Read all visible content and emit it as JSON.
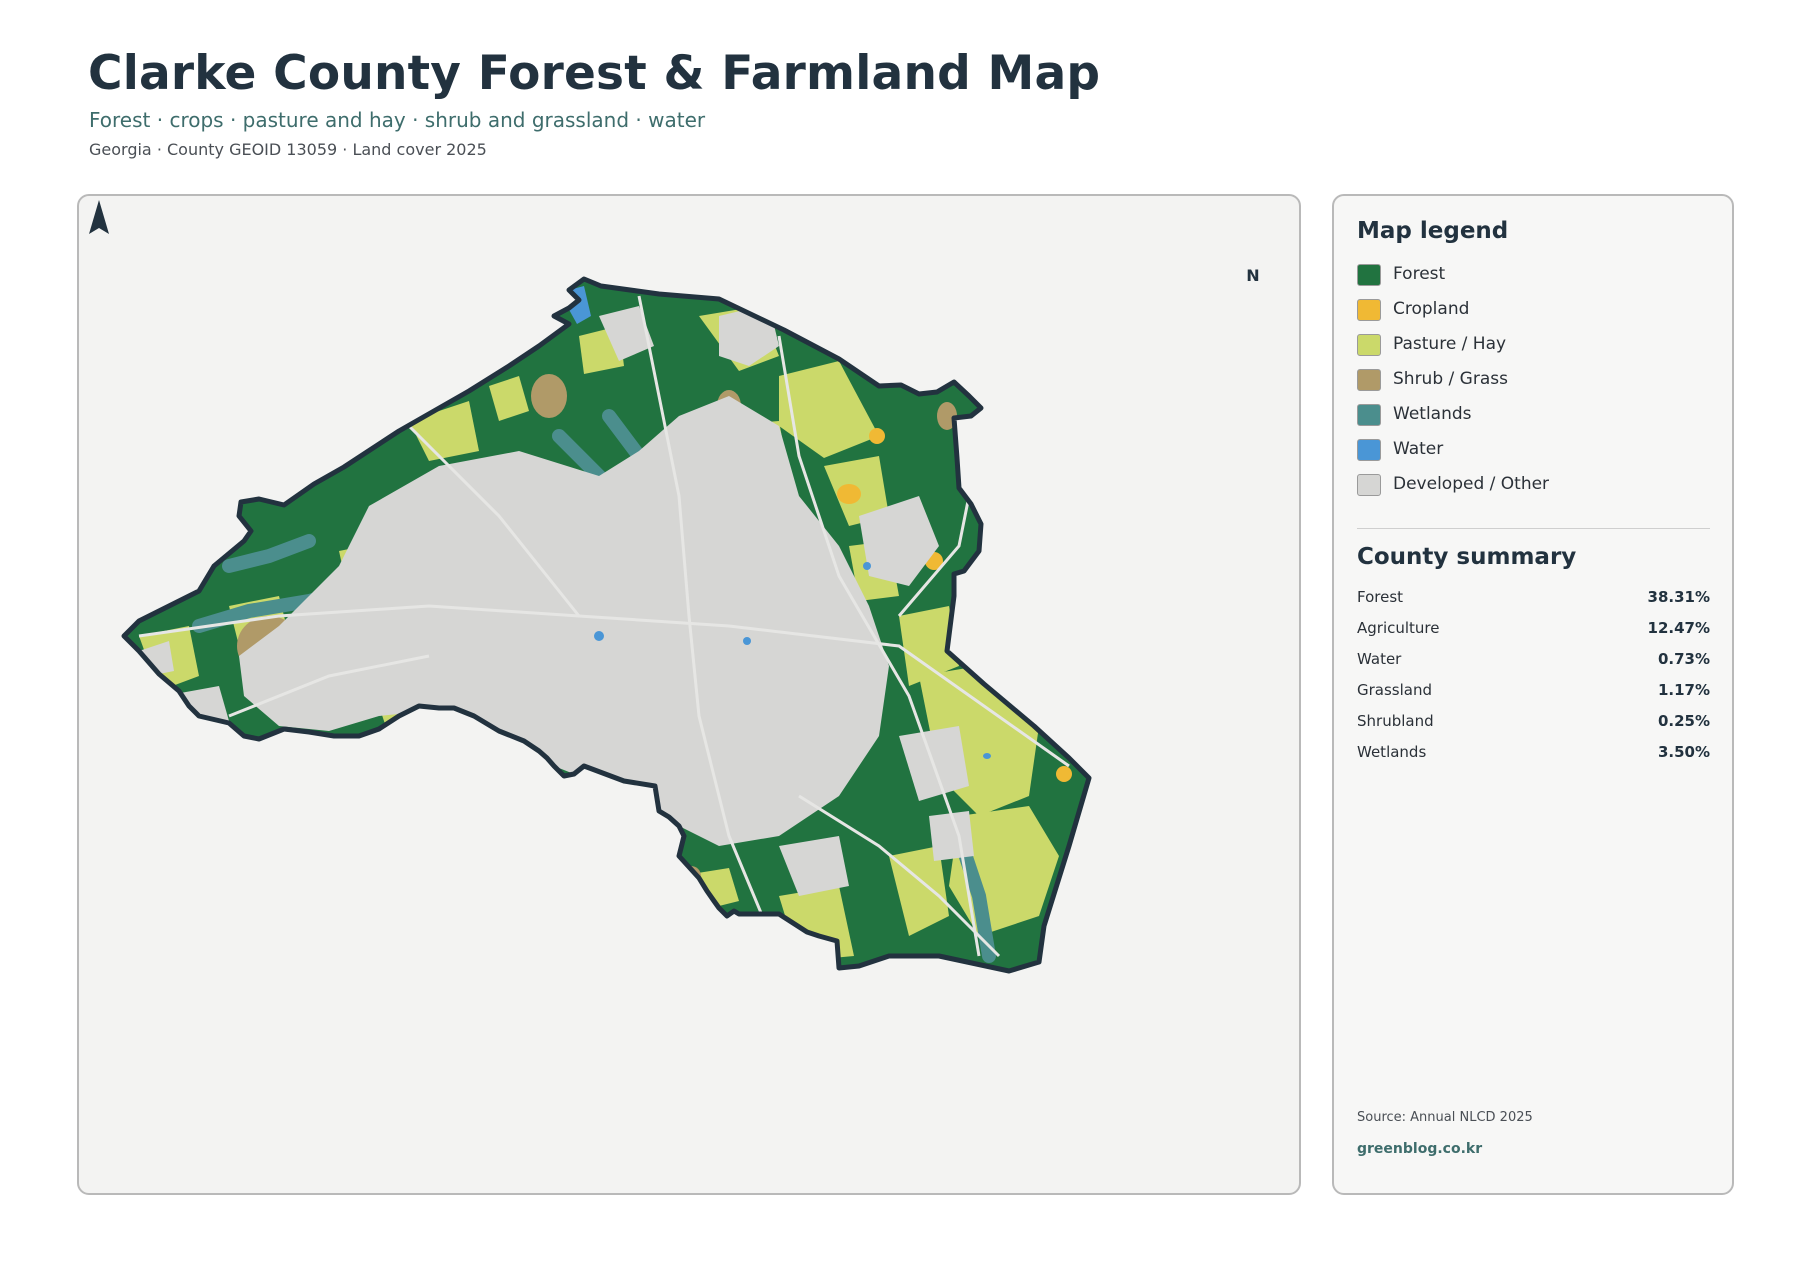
{
  "header": {
    "title": "Clarke County Forest & Farmland Map",
    "subtitle": "Forest · crops · pasture and hay · shrub and grassland · water",
    "meta": "Georgia · County GEOID 13059 · Land cover 2025"
  },
  "map": {
    "north_label": "N",
    "north_icon": "north-arrow-icon"
  },
  "legend": {
    "title": "Map legend",
    "items": [
      {
        "label": "Forest",
        "color": "#217340"
      },
      {
        "label": "Cropland",
        "color": "#f0b934"
      },
      {
        "label": "Pasture / Hay",
        "color": "#cbd96a"
      },
      {
        "label": "Shrub / Grass",
        "color": "#b09a68"
      },
      {
        "label": "Wetlands",
        "color": "#4b8e8d"
      },
      {
        "label": "Water",
        "color": "#4a96d6"
      },
      {
        "label": "Developed / Other",
        "color": "#d6d6d4"
      }
    ]
  },
  "summary": {
    "title": "County summary",
    "rows": [
      {
        "label": "Forest",
        "value": "38.31%"
      },
      {
        "label": "Agriculture",
        "value": "12.47%"
      },
      {
        "label": "Water",
        "value": "0.73%"
      },
      {
        "label": "Grassland",
        "value": "1.17%"
      },
      {
        "label": "Shrubland",
        "value": "0.25%"
      },
      {
        "label": "Wetlands",
        "value": "3.50%"
      }
    ]
  },
  "footer": {
    "source": "Source: Annual NLCD 2025",
    "brand": "greenblog.co.kr"
  }
}
